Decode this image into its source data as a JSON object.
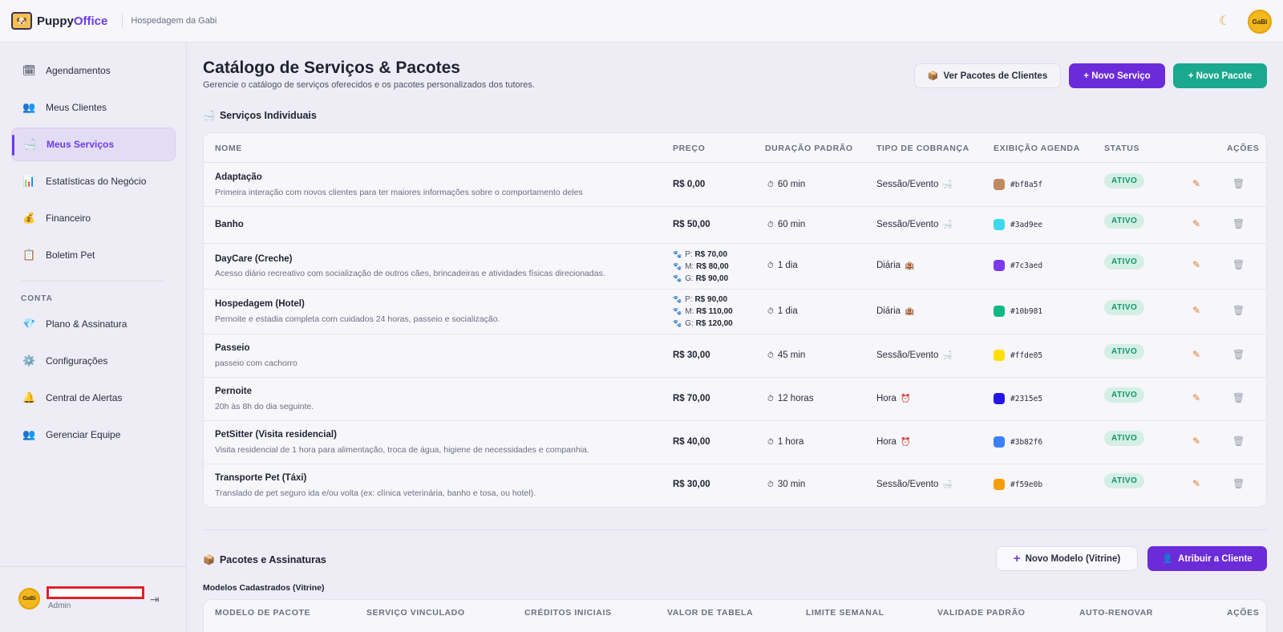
{
  "brand": {
    "name_a": "Puppy",
    "name_b": "Office",
    "subtitle": "Hospedagem da Gabi",
    "logo_text": "GaBi"
  },
  "theme_icon": "moon-icon",
  "sidebar": {
    "items": [
      {
        "icon": "🗓",
        "label": "Agendamentos"
      },
      {
        "icon": "👥",
        "label": "Meus Clientes"
      },
      {
        "icon": "🛁",
        "label": "Meus Serviços"
      },
      {
        "icon": "📊",
        "label": "Estatísticas do Negócio"
      },
      {
        "icon": "💰",
        "label": "Financeiro"
      },
      {
        "icon": "📋",
        "label": "Boletim Pet"
      }
    ],
    "section_label": "CONTA",
    "account_items": [
      {
        "icon": "💎",
        "label": "Plano & Assinatura"
      },
      {
        "icon": "⚙️",
        "label": "Configurações"
      },
      {
        "icon": "🔔",
        "label": "Central de Alertas"
      },
      {
        "icon": "👥",
        "label": "Gerenciar Equipe"
      }
    ],
    "user_role": "Admin",
    "user_avatar_text": "GaBi"
  },
  "main": {
    "title": "Catálogo de Serviços & Pacotes",
    "subtitle": "Gerencie o catálogo de serviços oferecidos e os pacotes personalizados dos tutores.",
    "buttons": {
      "view_packages": "Ver Pacotes de Clientes",
      "new_service": "+ Novo Serviço",
      "new_package": "+ Novo Pacote"
    },
    "services_title": "Serviços Individuais",
    "columns": [
      "NOME",
      "PREÇO",
      "DURAÇÃO PADRÃO",
      "TIPO DE COBRANÇA",
      "EXIBIÇÃO AGENDA",
      "STATUS",
      "AÇÕES"
    ],
    "services": [
      {
        "name": "Adaptação",
        "desc": "Primeira interação com novos clientes para ter maiores informações sobre o comportamento deles",
        "price": "R$ 0,00",
        "duration": "60 min",
        "billing": "Sessão/Evento",
        "billing_icon": "🛁",
        "color": "#bf8a5f",
        "status": "ATIVO"
      },
      {
        "name": "Banho",
        "desc": "",
        "price": "R$ 50,00",
        "duration": "60 min",
        "billing": "Sessão/Evento",
        "billing_icon": "🛁",
        "color": "#3ad9ee",
        "status": "ATIVO"
      },
      {
        "name": "DayCare (Creche)",
        "desc": "Acesso diário recreativo com socialização de outros cães, brincadeiras e atividades físicas direcionadas.",
        "tiers": [
          {
            "size": "P:",
            "price": "R$ 70,00"
          },
          {
            "size": "M:",
            "price": "R$ 80,00"
          },
          {
            "size": "G:",
            "price": "R$ 90,00"
          }
        ],
        "duration": "1 dia",
        "billing": "Diária",
        "billing_icon": "🏨",
        "color": "#7c3aed",
        "status": "ATIVO"
      },
      {
        "name": "Hospedagem (Hotel)",
        "desc": "Pernoite e estadia completa com cuidados 24 horas, passeio e socialização.",
        "tiers": [
          {
            "size": "P:",
            "price": "R$ 90,00"
          },
          {
            "size": "M:",
            "price": "R$ 110,00"
          },
          {
            "size": "G:",
            "price": "R$ 120,00"
          }
        ],
        "duration": "1 dia",
        "billing": "Diária",
        "billing_icon": "🏨",
        "color": "#10b981",
        "status": "ATIVO"
      },
      {
        "name": "Passeio",
        "desc": "passeio com cachorro",
        "price": "R$ 30,00",
        "duration": "45 min",
        "billing": "Sessão/Evento",
        "billing_icon": "🛁",
        "color": "#ffde05",
        "status": "ATIVO"
      },
      {
        "name": "Pernoite",
        "desc": "20h às 8h do dia seguinte.",
        "price": "R$ 70,00",
        "duration": "12 horas",
        "billing": "Hora",
        "billing_icon": "⏰",
        "color": "#2315e5",
        "status": "ATIVO"
      },
      {
        "name": "PetSitter (Visita residencial)",
        "desc": "Visita residencial de 1 hora para alimentação, troca de água, higiene de necessidades e companhia.",
        "price": "R$ 40,00",
        "duration": "1 hora",
        "billing": "Hora",
        "billing_icon": "⏰",
        "color": "#3b82f6",
        "status": "ATIVO"
      },
      {
        "name": "Transporte Pet (Táxi)",
        "desc": "Translado de pet seguro ida e/ou volta (ex: clínica veterinária, banho e tosa, ou hotel).",
        "price": "R$ 30,00",
        "duration": "30 min",
        "billing": "Sessão/Evento",
        "billing_icon": "🛁",
        "color": "#f59e0b",
        "status": "ATIVO"
      }
    ],
    "packages_title": "Pacotes e Assinaturas",
    "packages_buttons": {
      "new_model": "Novo Modelo (Vitrine)",
      "assign": "Atribuir a Cliente"
    },
    "models_subtitle": "Modelos Cadastrados (Vitrine)",
    "package_columns": [
      "MODELO DE PACOTE",
      "SERVIÇO VINCULADO",
      "CRÉDITOS INICIAIS",
      "VALOR DE TABELA",
      "LIMITE SEMANAL",
      "VALIDADE PADRÃO",
      "AUTO-RENOVAR",
      "AÇÕES"
    ]
  }
}
